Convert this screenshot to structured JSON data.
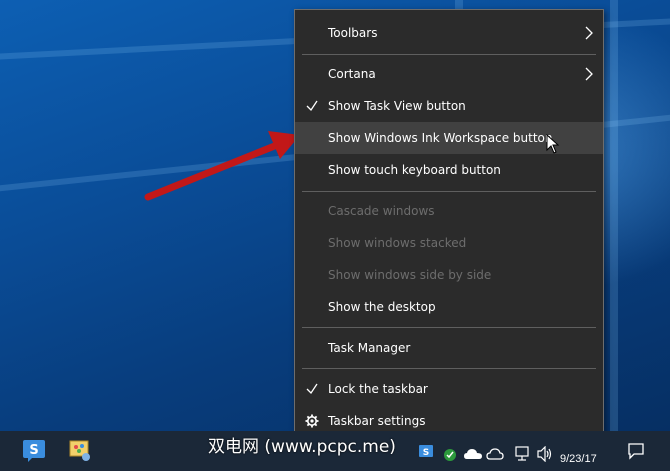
{
  "menu": {
    "items": [
      {
        "label": "Toolbars",
        "has_submenu": true
      },
      {
        "label": "Cortana",
        "has_submenu": true
      },
      {
        "label": "Show Task View button",
        "checked": true
      },
      {
        "label": "Show Windows Ink Workspace button",
        "highlighted": true
      },
      {
        "label": "Show touch keyboard button"
      },
      {
        "label": "Cascade windows",
        "disabled": true
      },
      {
        "label": "Show windows stacked",
        "disabled": true
      },
      {
        "label": "Show windows side by side",
        "disabled": true
      },
      {
        "label": "Show the desktop"
      },
      {
        "label": "Task Manager"
      },
      {
        "label": "Lock the taskbar",
        "checked": true
      },
      {
        "label": "Taskbar settings",
        "icon": "gear-icon"
      }
    ]
  },
  "taskbar": {
    "clock_date": "9/23/17",
    "watermark": "双电网 (www.pcpc.me)"
  },
  "colors": {
    "menu_bg": "#2b2b2b",
    "menu_hover": "#414141",
    "disabled_text": "#6d6d6d",
    "arrow_red": "#e32020"
  }
}
